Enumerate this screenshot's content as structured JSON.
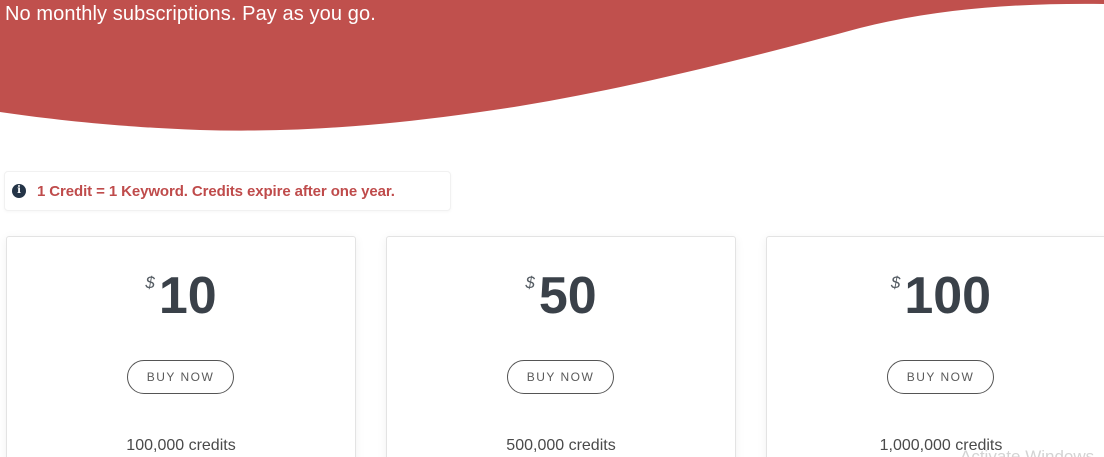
{
  "hero": {
    "tagline": "No monthly subscriptions. Pay as you go.",
    "background_color": "#c0504d"
  },
  "info_note": {
    "icon": "info-circle-icon",
    "text": "1 Credit = 1 Keyword.  Credits expire after one year.",
    "text_color": "#bf4b4b"
  },
  "plans": [
    {
      "currency": "$",
      "amount": "10",
      "button_label": "BUY NOW",
      "credits": "100,000 credits"
    },
    {
      "currency": "$",
      "amount": "50",
      "button_label": "BUY NOW",
      "credits": "500,000 credits"
    },
    {
      "currency": "$",
      "amount": "100",
      "button_label": "BUY NOW",
      "credits": "1,000,000 credits"
    }
  ],
  "watermark": {
    "text": "Activate Windows"
  }
}
